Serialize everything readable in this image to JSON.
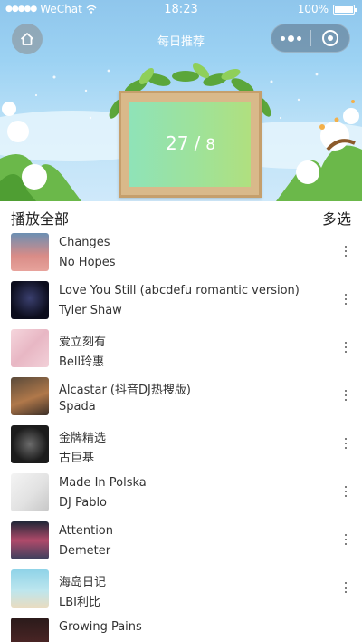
{
  "status_bar": {
    "carrier": "WeChat",
    "time": "18:23",
    "battery": "100%"
  },
  "nav": {
    "title": "每日推荐",
    "home_icon": "home-icon",
    "more_icon": "more-dots-icon",
    "close_icon": "mini-program-close-icon"
  },
  "banner": {
    "day": "27",
    "separator": "/",
    "month": "8"
  },
  "list_header": {
    "play_all": "播放全部",
    "multi_select": "多选"
  },
  "songs": [
    {
      "title": "Changes",
      "artist": "No Hopes"
    },
    {
      "title": "Love You Still (abcdefu romantic version)",
      "artist": "Tyler Shaw"
    },
    {
      "title": "爱立刻有",
      "artist": "Bell玲惠"
    },
    {
      "title": "Alcastar (抖音DJ热搜版)",
      "artist": "Spada"
    },
    {
      "title": "金牌精选",
      "artist": "古巨基"
    },
    {
      "title": "Made In Polska",
      "artist": "DJ Pablo"
    },
    {
      "title": "Attention",
      "artist": "Demeter"
    },
    {
      "title": "海岛日记",
      "artist": "LBI利比"
    },
    {
      "title": "Growing Pains",
      "artist": ""
    }
  ]
}
